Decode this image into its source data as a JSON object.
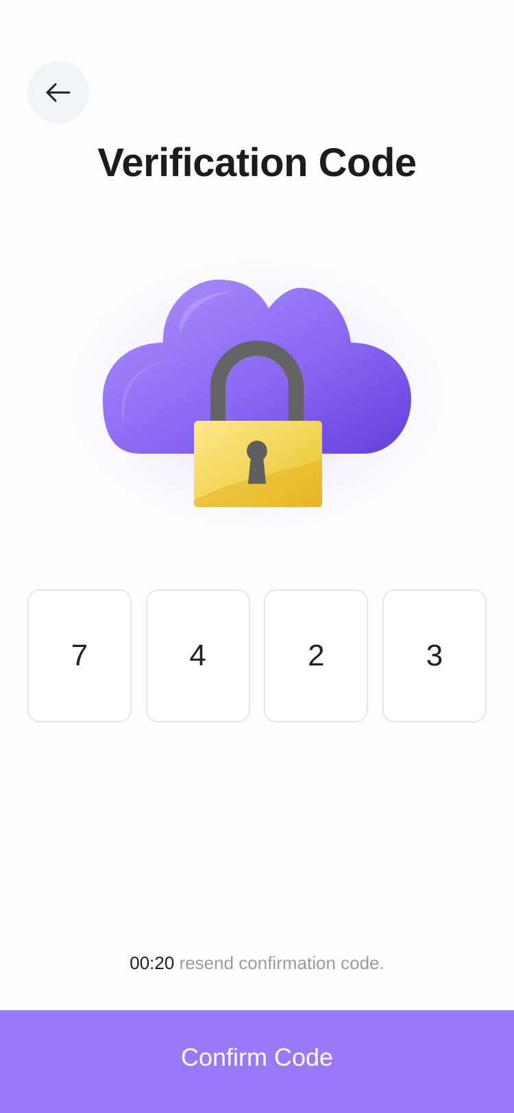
{
  "header": {
    "back_icon": "arrow-left-icon",
    "title": "Verification Code"
  },
  "illustration": {
    "icon": "cloud-lock-icon",
    "colors": {
      "cloud": "#8d6cf6",
      "lock_body": "#f2d14f",
      "shackle": "#616161"
    }
  },
  "code": {
    "digits": [
      "7",
      "4",
      "2",
      "3"
    ]
  },
  "resend": {
    "timer": "00:20",
    "text": "resend confirmation code."
  },
  "footer": {
    "confirm_label": "Confirm Code",
    "accent": "#9779fa"
  }
}
